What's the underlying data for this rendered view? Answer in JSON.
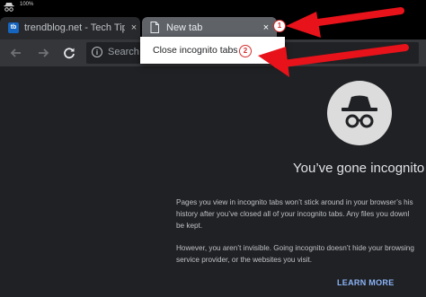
{
  "status_bar": {
    "text": "100%",
    "icon": "incognito-icon"
  },
  "tabs": [
    {
      "title": "trendblog.net - Tech Tips, Tu",
      "favicon": "tb",
      "close": "×"
    },
    {
      "title": "New tab",
      "icon": "document-icon",
      "close": "×"
    }
  ],
  "toolbar": {
    "back_icon": "back-arrow-icon",
    "forward_icon": "forward-arrow-icon",
    "reload_icon": "reload-icon",
    "info_icon": "i",
    "placeholder": "Search"
  },
  "context_menu": {
    "item": "Close incognito tabs"
  },
  "annotations": {
    "badge1": "1",
    "badge2": "2",
    "arrow_color": "#e8121a"
  },
  "page": {
    "title": "You’ve gone incognito",
    "para1": "Pages you view in incognito tabs won’t stick around in your browser’s his\nhistory after you’ve closed all of your incognito tabs. Any files you downl\nbe kept.",
    "para2": "However, you aren’t invisible. Going incognito doesn’t hide your browsing\nservice provider, or the websites you visit.",
    "learn_more": "LEARN MORE"
  },
  "colors": {
    "background": "#202124",
    "toolbar": "#35363a",
    "link": "#8ab4f8"
  }
}
